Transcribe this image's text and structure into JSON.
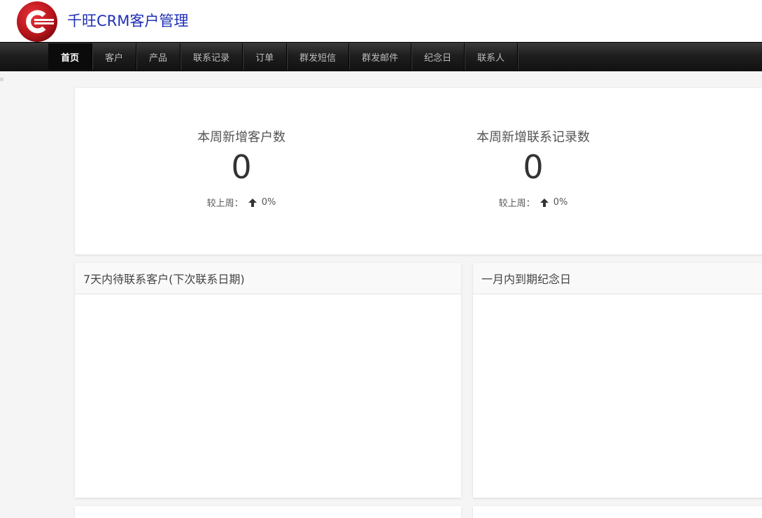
{
  "header": {
    "brand": "千旺CRM客户管理",
    "logo_color": "#c4161c"
  },
  "nav": {
    "items": [
      "首页",
      "客户",
      "产品",
      "联系记录",
      "订单",
      "群发短信",
      "群发邮件",
      "纪念日",
      "联系人"
    ],
    "active": 0
  },
  "stats": {
    "new_customers": {
      "title": "本周新增客户数",
      "value": "0",
      "compare_label": "较上周：",
      "change": "0%"
    },
    "new_contacts": {
      "title": "本周新增联系记录数",
      "value": "0",
      "compare_label": "较上周：",
      "change": "0%"
    }
  },
  "panels": {
    "upcoming_contacts": {
      "title": "7天内待联系客户(下次联系日期)"
    },
    "anniversaries": {
      "title": "一月内到期纪念日"
    }
  }
}
